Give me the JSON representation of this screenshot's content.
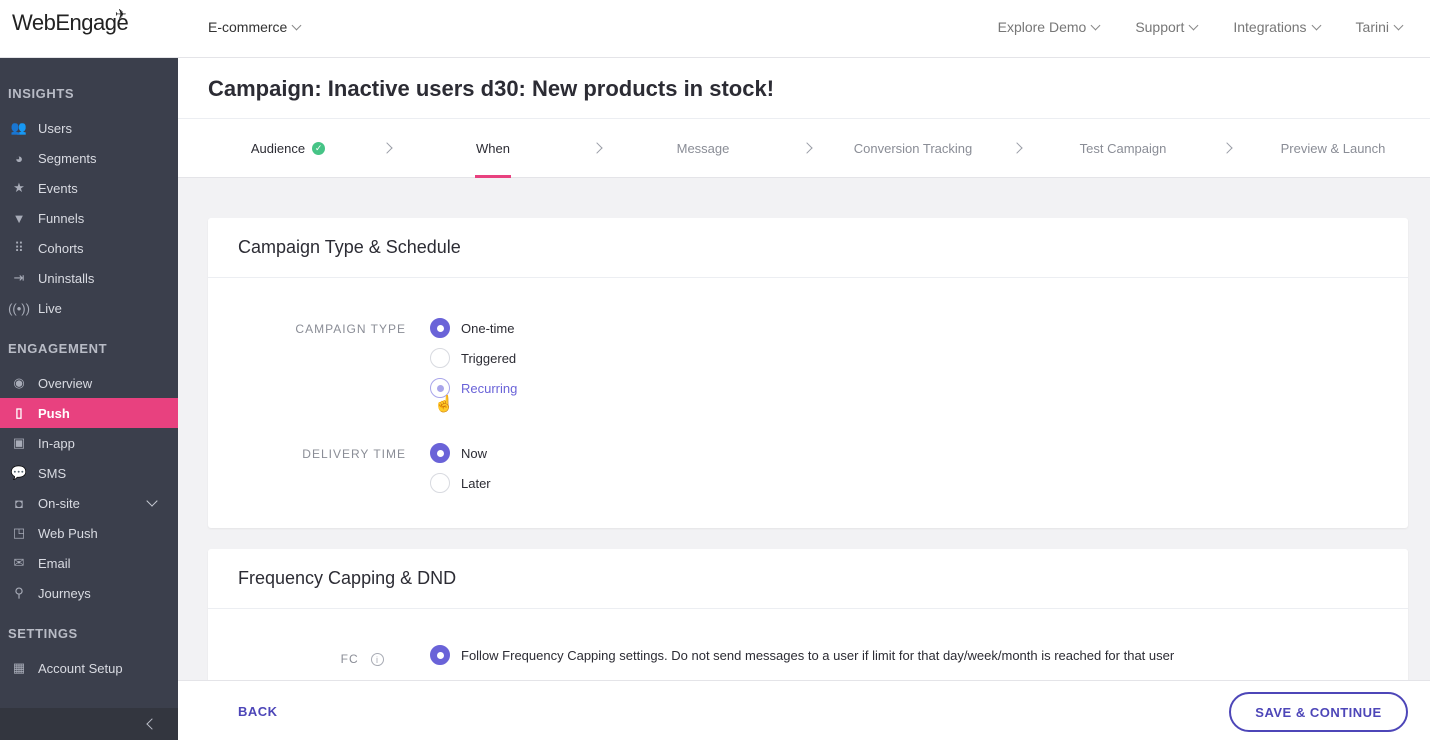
{
  "app": {
    "logo_text": "WebEngage",
    "project": "E-commerce"
  },
  "topnav": [
    {
      "label": "Explore Demo"
    },
    {
      "label": "Support"
    },
    {
      "label": "Integrations"
    },
    {
      "label": "Tarini"
    }
  ],
  "sidebar": {
    "sections": [
      {
        "title": "INSIGHTS"
      },
      {
        "title": "ENGAGEMENT"
      },
      {
        "title": "SETTINGS"
      }
    ],
    "items": [
      {
        "label": "Users",
        "icon": "users-icon"
      },
      {
        "label": "Segments",
        "icon": "pie-icon"
      },
      {
        "label": "Events",
        "icon": "star-icon"
      },
      {
        "label": "Funnels",
        "icon": "funnel-icon"
      },
      {
        "label": "Cohorts",
        "icon": "grid-icon"
      },
      {
        "label": "Uninstalls",
        "icon": "exit-icon"
      },
      {
        "label": "Live",
        "icon": "broadcast-icon"
      },
      {
        "label": "Overview",
        "icon": "eye-icon"
      },
      {
        "label": "Push",
        "icon": "mobile-icon",
        "active": true
      },
      {
        "label": "In-app",
        "icon": "inapp-icon"
      },
      {
        "label": "SMS",
        "icon": "sms-icon"
      },
      {
        "label": "On-site",
        "icon": "window-icon"
      },
      {
        "label": "Web Push",
        "icon": "webpush-icon"
      },
      {
        "label": "Email",
        "icon": "email-icon"
      },
      {
        "label": "Journeys",
        "icon": "rocket-icon"
      },
      {
        "label": "Account Setup",
        "icon": "dashboard-icon"
      }
    ]
  },
  "page": {
    "title": "Campaign: Inactive users d30: New products in stock!"
  },
  "steps": [
    {
      "label": "Audience",
      "status": "done"
    },
    {
      "label": "When",
      "status": "current"
    },
    {
      "label": "Message",
      "status": "pending"
    },
    {
      "label": "Conversion Tracking",
      "status": "pending"
    },
    {
      "label": "Test Campaign",
      "status": "pending"
    },
    {
      "label": "Preview & Launch",
      "status": "pending"
    }
  ],
  "schedule_card": {
    "title": "Campaign Type & Schedule",
    "campaign_type_label": "CAMPAIGN TYPE",
    "campaign_type_options": [
      "One-time",
      "Triggered",
      "Recurring"
    ],
    "campaign_type_selected": "One-time",
    "delivery_time_label": "DELIVERY TIME",
    "delivery_time_options": [
      "Now",
      "Later"
    ],
    "delivery_time_selected": "Now"
  },
  "fc_card": {
    "title": "Frequency Capping & DND",
    "fc_label": "FC",
    "fc_option_1": "Follow Frequency Capping settings. Do not send messages to a user if limit for that day/week/month is reached for that user"
  },
  "footer": {
    "back_label": "BACK",
    "save_label": "SAVE & CONTINUE"
  },
  "colors": {
    "accent_pink": "#e8417f",
    "primary_purple": "#6a63d8",
    "sidebar_bg": "#3b3f4c",
    "success_green": "#46c486"
  }
}
